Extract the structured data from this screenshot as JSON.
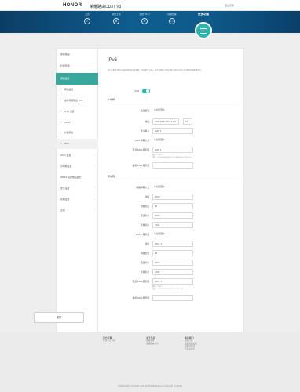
{
  "header": {
    "brand": "HONOR",
    "title": "荣耀路由CD37 V3",
    "logout": "退出登录"
  },
  "nav": {
    "items": [
      {
        "label": "主页",
        "icon": "⌂"
      },
      {
        "label": "我要上网",
        "icon": "⊕"
      },
      {
        "label": "我的 Wi-Fi",
        "icon": "≋"
      },
      {
        "label": "终端管理",
        "icon": "▭"
      }
    ],
    "more": "更多功能"
  },
  "sidebar": {
    "items": [
      {
        "label": "我的路由"
      },
      {
        "label": "升级管理"
      },
      {
        "label": "网络设置"
      }
    ],
    "subitems": [
      {
        "label": "网络模式"
      },
      {
        "label": "虚拟专用网络 VPN"
      },
      {
        "label": "IPTV 设置"
      },
      {
        "label": "UPnP"
      },
      {
        "label": "智能网络"
      },
      {
        "label": "IPv6"
      }
    ],
    "items2": [
      {
        "label": "Wi-Fi 设置"
      },
      {
        "label": "局域网设置"
      },
      {
        "label": "DDNS 动态域名服务"
      },
      {
        "label": "安全设置"
      },
      {
        "label": "系统设置"
      },
      {
        "label": "应用"
      }
    ]
  },
  "page": {
    "title": "IPv6",
    "description": "您可以配置 IPv6 功能使用的协议等参数，开启 IPv6 功能。IPv6 设置与 WAN 侧的上网方式和 LAN 侧的终端配置有关。",
    "ipv6_label": "IPv6",
    "ipv6_enabled": true,
    "wan_title": "广域网",
    "wan": {
      "conn_type_label": "连接类型",
      "conn_type": "手动配置",
      "addr_label": "地址",
      "addr": "2409:8250:3001:1797",
      "prefix": "64",
      "gateway_label": "默认网关",
      "gateway": "fe80::1",
      "dns_label": "DNS 获取方式",
      "dns": "手动配置",
      "primary_dns_label": "首选 DNS 服务器",
      "primary_dns": "fe80::1",
      "hint": "例如：2001::1\n或者：2409:8250:3001:5C2C:00A5:78D:2C1E::123",
      "secondary_dns_label": "备用 DNS 服务器",
      "secondary_dns": ""
    },
    "lan_title": "局域网",
    "lan": {
      "prefix_assign_label": "前缀获取方式",
      "prefix_assign": "手动配置",
      "prefix_label": "前缀",
      "prefix": "2001::",
      "prefix_len_label": "前缀长度",
      "prefix_len": "48",
      "preferred_label": "首选寿命",
      "preferred": "3600",
      "valid_label": "有效寿命",
      "valid": "7200",
      "dhcp_label": "DHCP 服务器",
      "dhcp": "手动配置",
      "addr_label": "地址",
      "addr": "2001::1",
      "addr_prefix_label": "前缀长度",
      "addr_prefix": "48",
      "addr_preferred_label": "首选寿命",
      "addr_preferred": "3600",
      "addr_valid_label": "有效寿命",
      "addr_valid": "7200",
      "dns_label": "首选 DNS 服务器",
      "dns": "2001::1",
      "hint": "例如：2001::1\n或者：2409:8250:3001:5C2C:00A5::123",
      "secondary_dns_label": "备用 DNS 服务器",
      "secondary_dns": ""
    },
    "save": "保存"
  },
  "footer": {
    "cols": [
      {
        "title": "官方下载",
        "links": [
          "智慧生活 App"
        ]
      },
      {
        "title": "关于产品",
        "links": [
          "荣耀商城",
          "荣耀路由系列"
        ]
      },
      {
        "title": "联系我们",
        "links": [
          "荣耀官网",
          "荣耀客服热线",
          "荣耀俱乐部",
          "开发者社区"
        ]
      }
    ],
    "copyright": "荣耀终端有限公司 ©2020-2023 版权所有 粤ICP备xxxx号 隐私政策 · 开源声明"
  },
  "colors": {
    "accent": "#2bb5ad",
    "nav_dark": "#0b3e66",
    "nav_mid": "#0f5d8f",
    "sidebar_selected": "#38a89d"
  }
}
